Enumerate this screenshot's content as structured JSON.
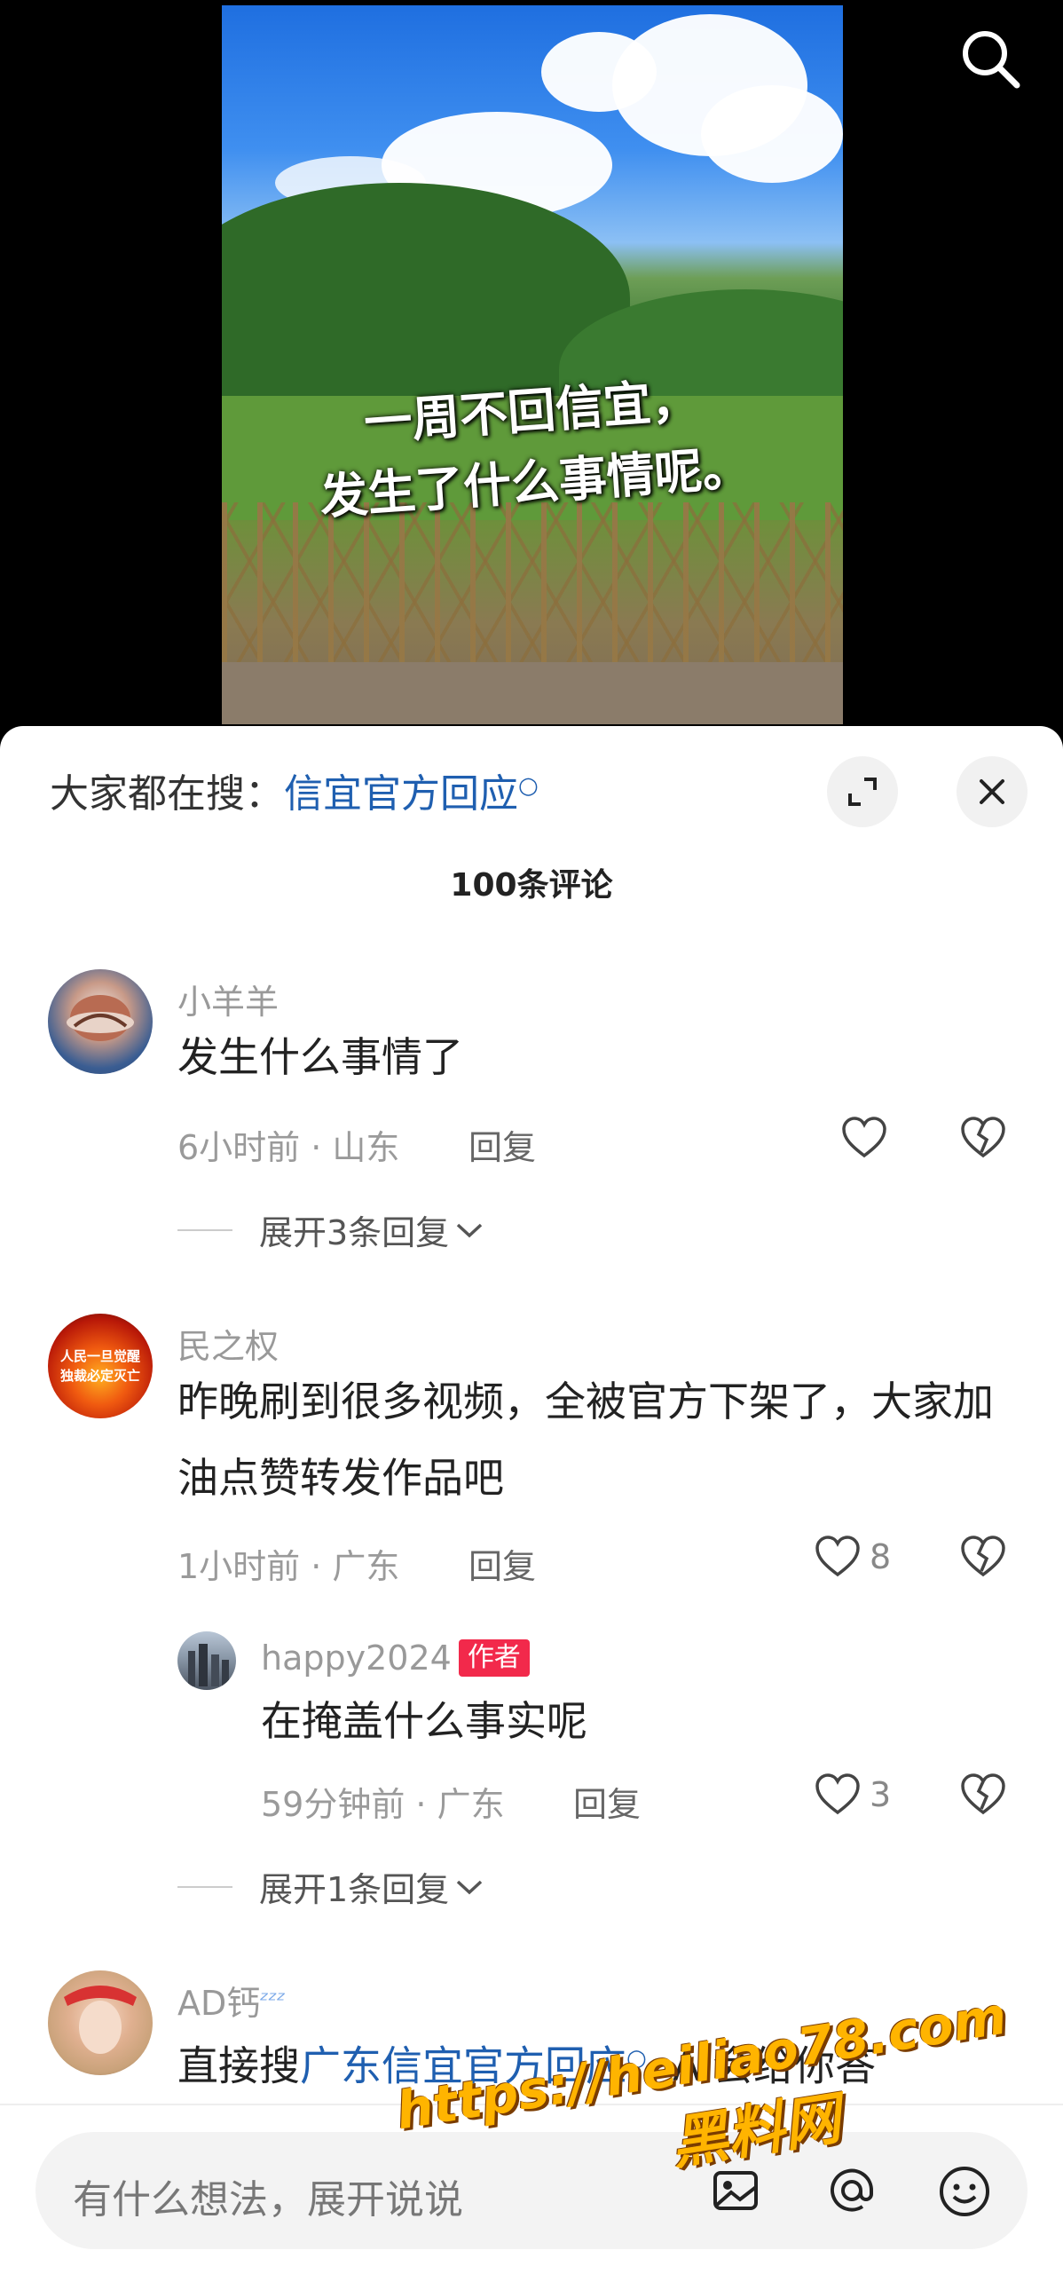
{
  "video": {
    "caption_line1": "一周不回信宜，",
    "caption_line2": "发生了什么事情呢。",
    "search_icon": "search-icon"
  },
  "sheet": {
    "hot_search_label": "大家都在搜：",
    "hot_search_keyword": "信宜官方回应",
    "comment_count": "100条评论"
  },
  "comments": [
    {
      "username": "小羊羊",
      "text": "发生什么事情了",
      "time_location": "6小时前 · 山东",
      "reply_label": "回复",
      "likes": "",
      "expand_label": "展开3条回复"
    },
    {
      "username": "民之权",
      "avatar_text": "人民一旦觉醒 独裁必定灭亡",
      "text": "昨晚刷到很多视频，全被官方下架了，大家加油点赞转发作品吧",
      "time_location": "1小时前 · 广东",
      "reply_label": "回复",
      "likes": "8",
      "reply": {
        "username": "happy2024",
        "badge": "作者",
        "text": "在掩盖什么事实呢",
        "time_location": "59分钟前 · 广东",
        "reply_label": "回复",
        "likes": "3"
      },
      "expand_label": "展开1条回复"
    },
    {
      "username": "AD钙",
      "username_icon": "zzz-icon",
      "text_prefix": "直接搜",
      "text_link": "广东信宜官方回应",
      "text_suffix": "AI会给你答"
    }
  ],
  "input": {
    "placeholder": "有什么想法，展开说说"
  },
  "watermark": {
    "url": "https://heiliao78.com",
    "name": "黑料网"
  },
  "colors": {
    "link": "#1f5fb0",
    "author_badge": "#f2294b",
    "watermark": "#ffb400"
  }
}
